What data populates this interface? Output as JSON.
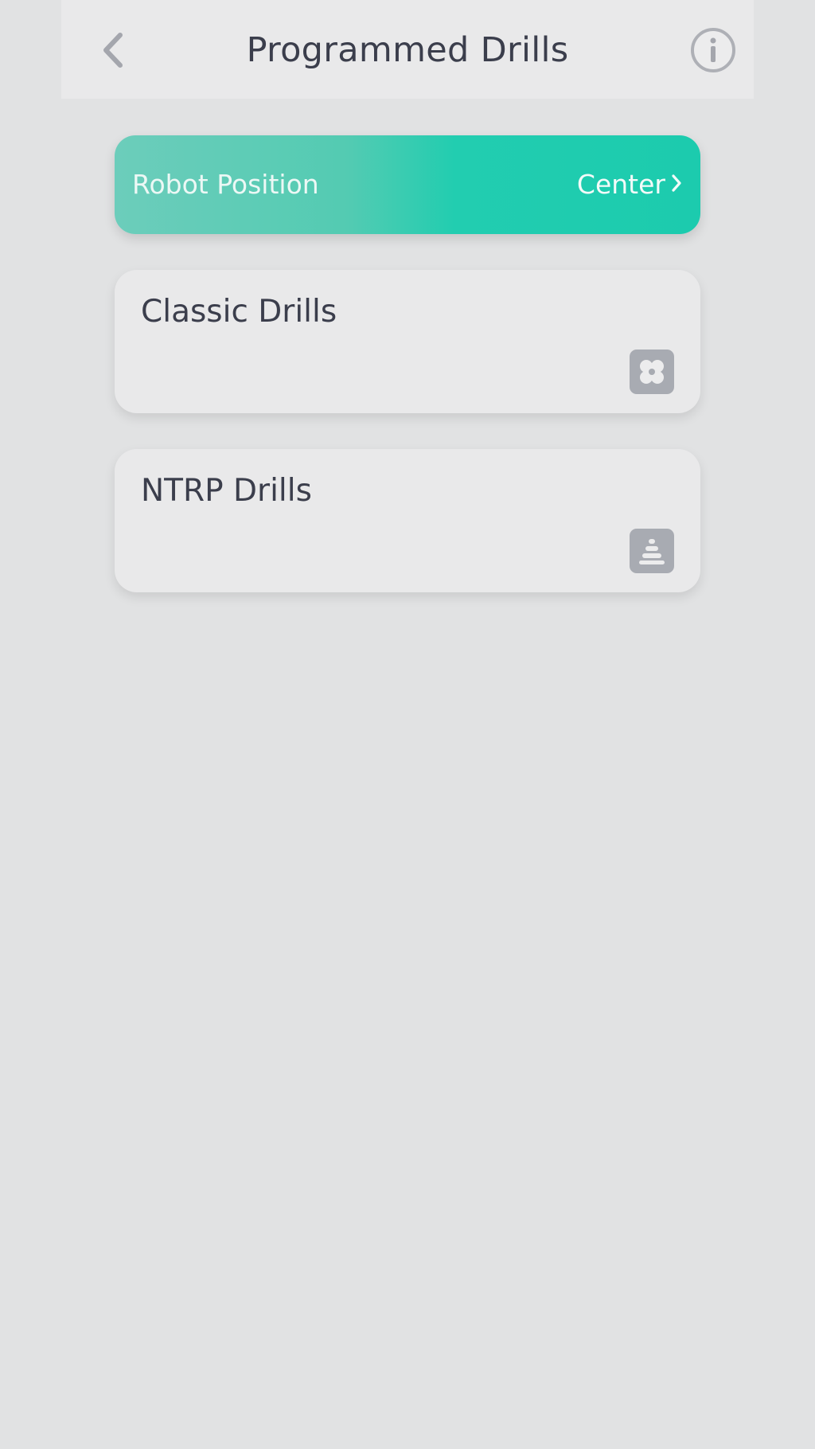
{
  "header": {
    "title": "Programmed Drills",
    "back_icon": "chevron-left-icon",
    "info_icon": "info-circle-icon"
  },
  "robot_position": {
    "label": "Robot Position",
    "value": "Center",
    "icon": "chevron-right-icon",
    "accent_color": "#1ccbae"
  },
  "drills": [
    {
      "title": "Classic Drills",
      "icon": "four-circles-icon"
    },
    {
      "title": "NTRP Drills",
      "icon": "stacked-bars-icon"
    }
  ]
}
